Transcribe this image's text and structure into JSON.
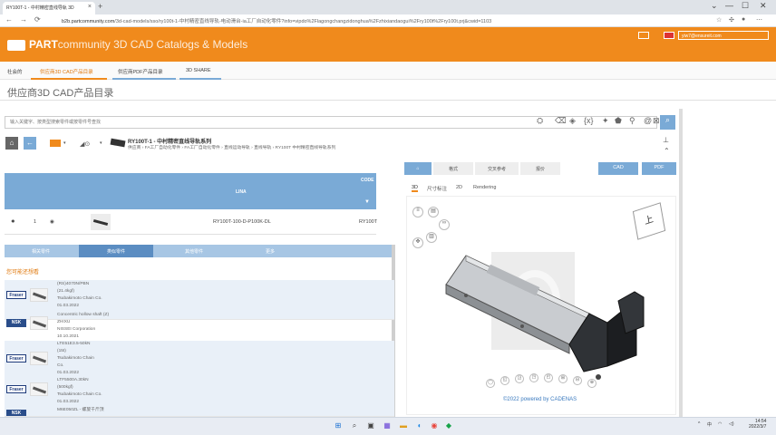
{
  "browser": {
    "tab_title": "RY100T-1 - 中村精密直线导轨 3D",
    "tab_close": "×",
    "new_tab": "+",
    "window_controls": [
      "⌄",
      "—",
      "☐",
      "✕"
    ],
    "nav_back": "←",
    "nav_forward": "→",
    "nav_reload": "⟳",
    "url_host": "b2b.partcommunity.com",
    "url_path": "/3d-cad-models/sso/ry100t-1-中村精密直线导轨-电动滑台-ia工厂自动化零件?info=vipdo%2Flagongchangzidonghua%2Fzhixiandaogui%2Fry100t%2Fry100t.prj&cwid=1103"
  },
  "header": {
    "brand_strong": "PART",
    "brand_rest": "community  3D CAD Catalogs & Models",
    "user": "yiw7@ensureit.com"
  },
  "nav": {
    "items": [
      "社会的",
      "供应商3D CAD产品目录",
      "供应商PDF产品目录",
      "3D SHARE"
    ]
  },
  "page_title": "供应商3D CAD产品目录",
  "search": {
    "placeholder": "输入关键字、按类型搜索零件或按零件号查找",
    "icon": "⌕"
  },
  "product": {
    "title": "RY100T-1 - 中村精密直线导轨系列",
    "breadcrumbs": "供应商 › FA工厂自动化零件 › FA工厂自动化零件 › 直线运动导轨 › 直线导轨 › RY100T 中村精密直线导轨系列"
  },
  "table": {
    "headers": [
      "LINA",
      "CODE"
    ],
    "filter_icon": "▼",
    "row": {
      "index": "1",
      "name": "RY100T-100-D-P100K-DL",
      "code": "RY100T"
    }
  },
  "lower_tabs": [
    "相关零件",
    "类似零件",
    "其他零件",
    "更多"
  ],
  "section_label": "您可能还想看",
  "items": [
    {
      "maker": "Fraser",
      "lines": [
        "(RS)4070N/PBN",
        "(21.4kgf)",
        "Tsubakimoto Chain Co.",
        "01.03.2022"
      ]
    },
    {
      "maker": "NSK",
      "lines": [
        "Concentric hollow shaft (Z)",
        "ZHIXU",
        "NISSEI Corporation",
        "10.10.2021"
      ]
    },
    {
      "maker": "Fraser",
      "lines": [
        "LTE51E3.5-50kN",
        "(15t)",
        "Tsubakimoto Chain",
        "Co.",
        "01.03.2022"
      ]
    },
    {
      "maker": "Fraser",
      "lines": [
        "LTF5500A.30kN",
        "(500kgf)",
        "Tsubakimoto Chain Co.",
        "01.03.2022"
      ]
    },
    {
      "maker": "NSK",
      "lines": [
        "M6E050ZL - 螺旋千斤顶"
      ]
    }
  ],
  "viewer": {
    "top_tabs": [
      "⌂",
      "格式",
      "交叉参考",
      "报价"
    ],
    "buttons": [
      "CAD",
      "PDF"
    ],
    "sub_tabs": [
      "3D",
      "尺寸标注",
      "2D",
      "Rendering"
    ],
    "cube_label": "上",
    "powered": "©2022 powered by CADENAS"
  },
  "taskbar": {
    "time": "14:54",
    "date": "2022/3/7",
    "lang": "中"
  }
}
